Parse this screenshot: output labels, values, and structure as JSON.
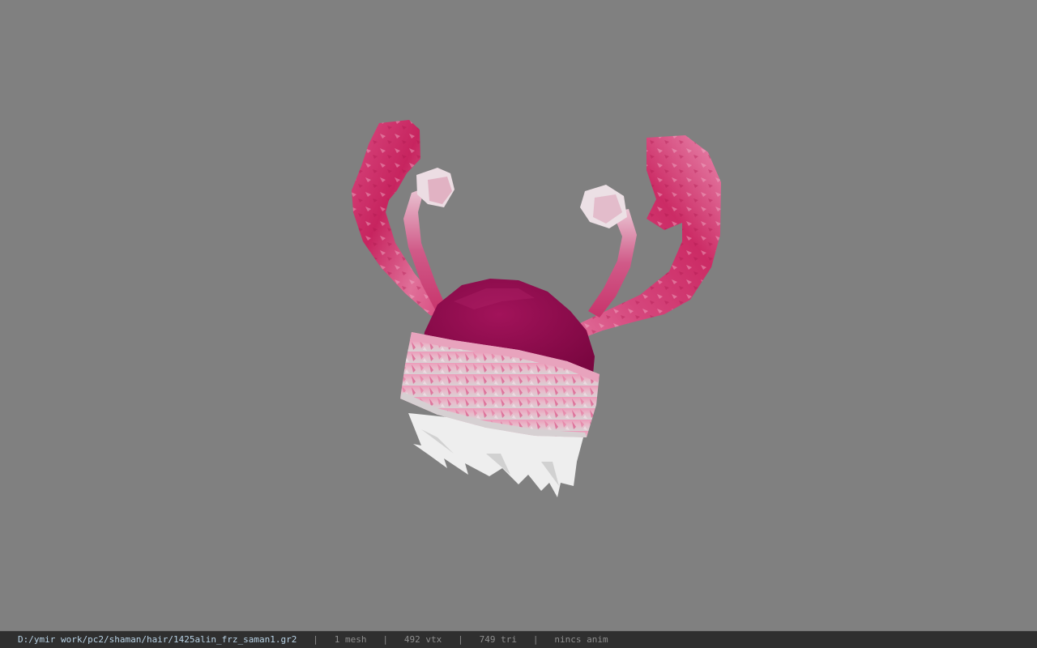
{
  "viewer": {
    "background_color": "#808080",
    "model_icon": "hat-with-antlers-model",
    "model_colors": {
      "cap": "#8e0a4c",
      "antler": "#d0306c",
      "fur": "#e7a9bf",
      "hair": "#eeeeee"
    }
  },
  "statusbar": {
    "file_path": "D:/ymir work/pc2/shaman/hair/1425alin_frz_saman1.gr2",
    "separator": "|",
    "mesh_count": "1 mesh",
    "vertex_count": "492 vtx",
    "triangle_count": "749 tri",
    "anim_status": "nincs anim"
  }
}
